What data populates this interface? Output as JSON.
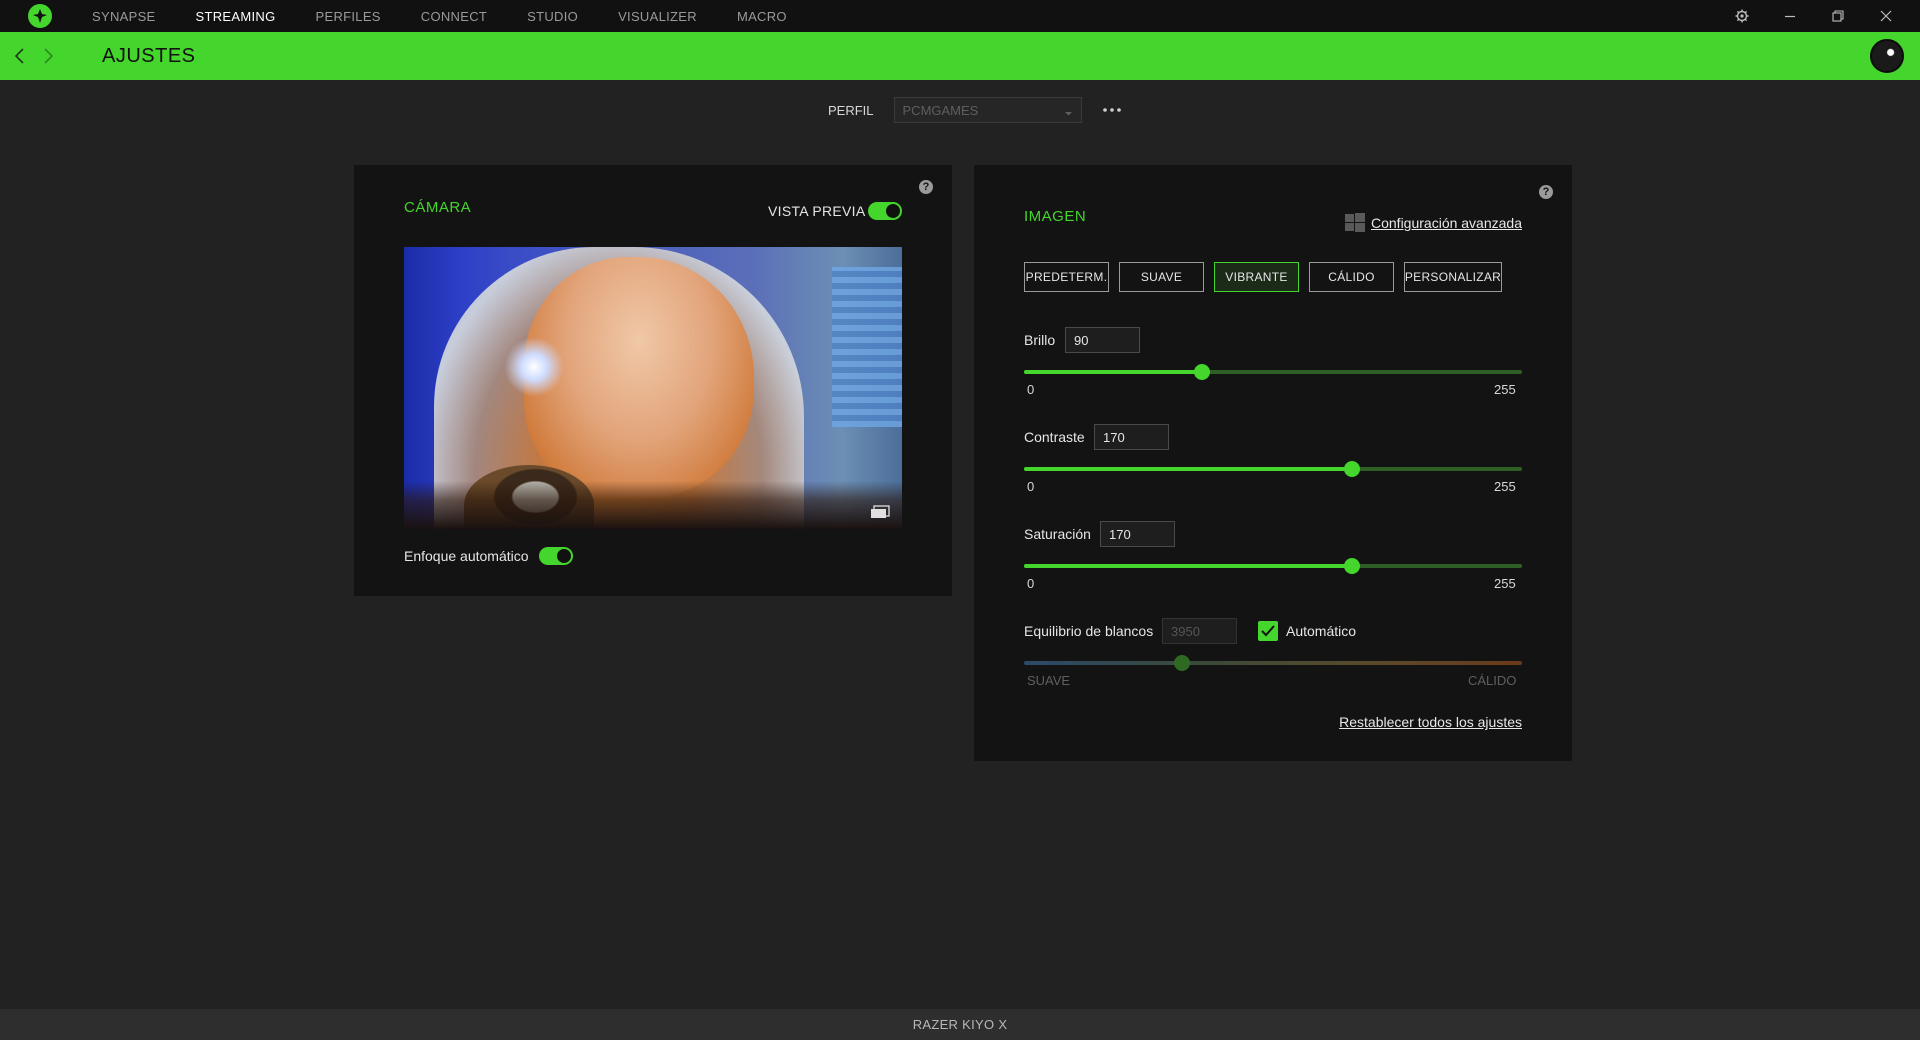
{
  "nav": {
    "tabs": [
      {
        "label": "SYNAPSE",
        "active": false
      },
      {
        "label": "STREAMING",
        "active": true
      },
      {
        "label": "PERFILES",
        "active": false
      },
      {
        "label": "CONNECT",
        "active": false
      },
      {
        "label": "STUDIO",
        "active": false
      },
      {
        "label": "VISUALIZER",
        "active": false
      },
      {
        "label": "MACRO",
        "active": false
      }
    ]
  },
  "header": {
    "title": "AJUSTES"
  },
  "profile": {
    "label": "PERFIL",
    "value": "PCMGAMES"
  },
  "camera": {
    "title": "CÁMARA",
    "preview_label": "VISTA PREVIA",
    "preview_on": true,
    "autofocus_label": "Enfoque automático",
    "autofocus_on": true
  },
  "image": {
    "title": "IMAGEN",
    "advanced_link": "Configuración avanzada",
    "presets": [
      {
        "label": "PREDETERM.",
        "active": false
      },
      {
        "label": "SUAVE",
        "active": false
      },
      {
        "label": "VIBRANTE",
        "active": true
      },
      {
        "label": "CÁLIDO",
        "active": false
      },
      {
        "label": "PERSONALIZAR",
        "active": false
      }
    ],
    "sliders": [
      {
        "label": "Brillo",
        "value": "90",
        "min": "0",
        "max": "255",
        "fraction": 0.358
      },
      {
        "label": "Contraste",
        "value": "170",
        "min": "0",
        "max": "255",
        "fraction": 0.659
      },
      {
        "label": "Saturación",
        "value": "170",
        "min": "0",
        "max": "255",
        "fraction": 0.659
      }
    ],
    "white_balance": {
      "label": "Equilibrio de blancos",
      "value": "3950",
      "auto_label": "Automático",
      "auto_checked": true,
      "min_label": "SUAVE",
      "max_label": "CÁLIDO",
      "fraction": 0.318
    },
    "reset_link": "Restablecer todos los ajustes"
  },
  "footer": {
    "device": "RAZER KIYO X"
  },
  "colors": {
    "accent": "#44d62c",
    "background": "#222222",
    "panel": "#131313",
    "topbar": "#111111"
  },
  "icons": [
    "razer-logo-icon",
    "gear-icon",
    "minimize-icon",
    "restore-icon",
    "close-icon",
    "chevron-left-icon",
    "chevron-right-icon",
    "more-icon",
    "help-icon",
    "windows-icon",
    "fullscreen-icon",
    "check-icon"
  ]
}
